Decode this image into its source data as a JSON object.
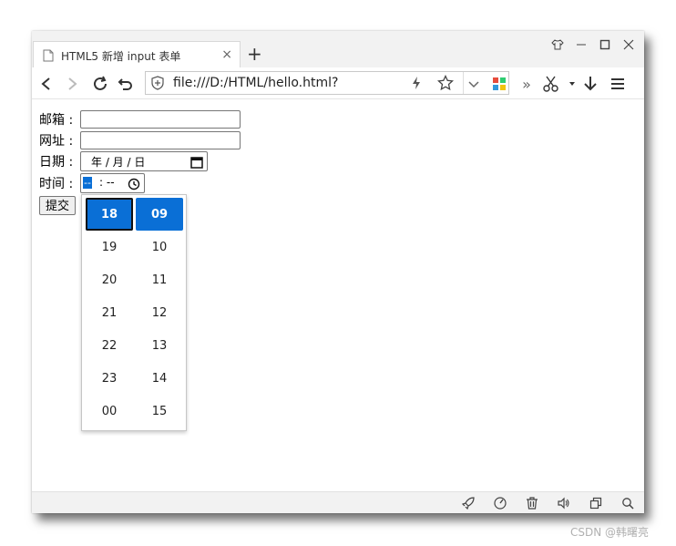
{
  "tab": {
    "title": "HTML5 新增 input 表单",
    "close": "×"
  },
  "new_tab": "+",
  "address": {
    "url": "file:///D:/HTML/hello.html?"
  },
  "toolbar": {
    "more": "»"
  },
  "form": {
    "email_label": "邮箱 :",
    "url_label": "网址 :",
    "date_label": "日期 :",
    "date_placeholder": "年 / 月 / 日",
    "time_label": "时间 :",
    "time_hour": "--",
    "time_rest": ": --",
    "submit_label": "提交"
  },
  "time_picker": {
    "hours": [
      "18",
      "19",
      "20",
      "21",
      "22",
      "23",
      "00"
    ],
    "minutes": [
      "09",
      "10",
      "11",
      "12",
      "13",
      "14",
      "15"
    ],
    "selected_hour": "18",
    "selected_minute": "09"
  },
  "watermark": "CSDN @韩曙亮",
  "colors": {
    "accent": "#0a6fd6"
  }
}
